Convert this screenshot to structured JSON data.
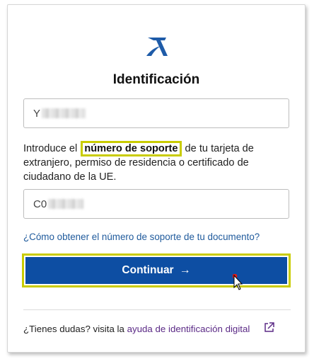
{
  "header": {
    "title": "Identificación",
    "logo": "aeat-logo"
  },
  "form": {
    "id_field": {
      "value": "Y"
    },
    "support_field": {
      "value": "C0"
    },
    "description": {
      "prefix": "Introduce el ",
      "highlight": "número de soporte",
      "suffix": " de tu tarjeta de extranjero, permiso de residencia o certificado de ciudadano de la UE."
    },
    "help_link": "¿Cómo obtener el número de soporte de tu documento?",
    "submit": {
      "label": "Continuar",
      "icon": "arrow-right-icon"
    }
  },
  "footer": {
    "text": "¿Tienes dudas? visita la ",
    "link": "ayuda de identificación digital",
    "icon": "external-link-icon"
  },
  "colors": {
    "primary": "#0d4ea3",
    "highlight": "#c9cc00",
    "link": "#1f5a9c",
    "visited_link": "#5b2a86"
  }
}
